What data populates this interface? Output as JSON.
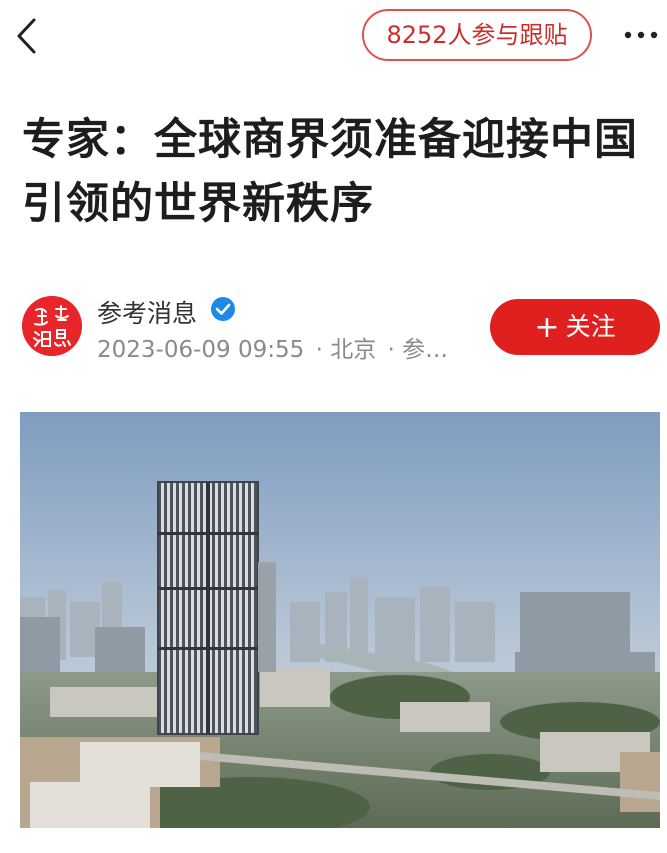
{
  "header": {
    "participants_label": "8252人参与跟贴",
    "back_icon": "chevron-left-icon",
    "more_icon": "more-horizontal-icon"
  },
  "article": {
    "title": "专家：全球商界须准备迎接中国引领的世界新秩序"
  },
  "author": {
    "name": "参考消息",
    "avatar_text": "参考消息",
    "verified_icon": "verified-badge-icon",
    "date": "2023-06-09 09:55",
    "location": "· 北京",
    "source": "· 参…",
    "follow_label": "关注",
    "follow_plus": "+"
  },
  "colors": {
    "accent_red": "#e0201f",
    "badge_blue": "#1e88e5"
  }
}
